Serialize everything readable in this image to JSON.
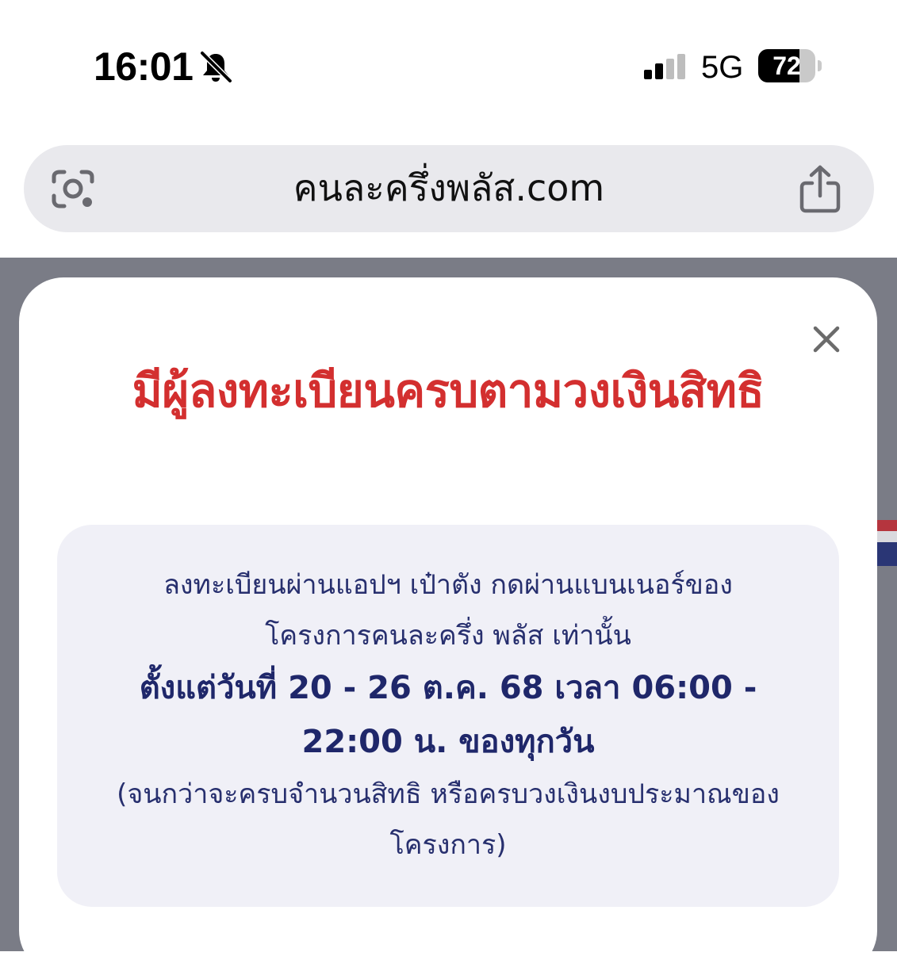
{
  "status_bar": {
    "time": "16:01",
    "silent_icon": "bell-slash-icon",
    "signal_icon": "cellular-signal-icon",
    "network": "5G",
    "battery_level": "72",
    "battery_fraction": 0.72
  },
  "address_bar": {
    "lens_icon": "camera-lens-icon",
    "url": "คนละครึ่งพลัส.com",
    "share_icon": "share-icon"
  },
  "modal": {
    "close_icon": "close-icon",
    "title": "มีผู้ลงทะเบียนครบตามวงเงินสิทธิ",
    "info": {
      "line1": "ลงทะเบียนผ่านแอปฯ เป๋าตัง กดผ่านแบนเนอร์ของ",
      "line2": "โครงการคนละครึ่ง พลัส เท่านั้น",
      "date_line1": "ตั้งแต่วันที่ 20 - 26 ต.ค. 68 เวลา 06:00 -",
      "date_line2": "22:00 น. ของทุกวัน",
      "note_line1": "(จนกว่าจะครบจำนวนสิทธิ หรือครบวงเงินงบประมาณของ",
      "note_line2": "โครงการ)"
    }
  },
  "colors": {
    "title_red": "#d32f2f",
    "info_text_navy": "#272f6e",
    "info_box_bg": "#f0f0f7",
    "overlay_gray": "#7a7c86",
    "address_bar_bg": "#e9e9ed"
  }
}
